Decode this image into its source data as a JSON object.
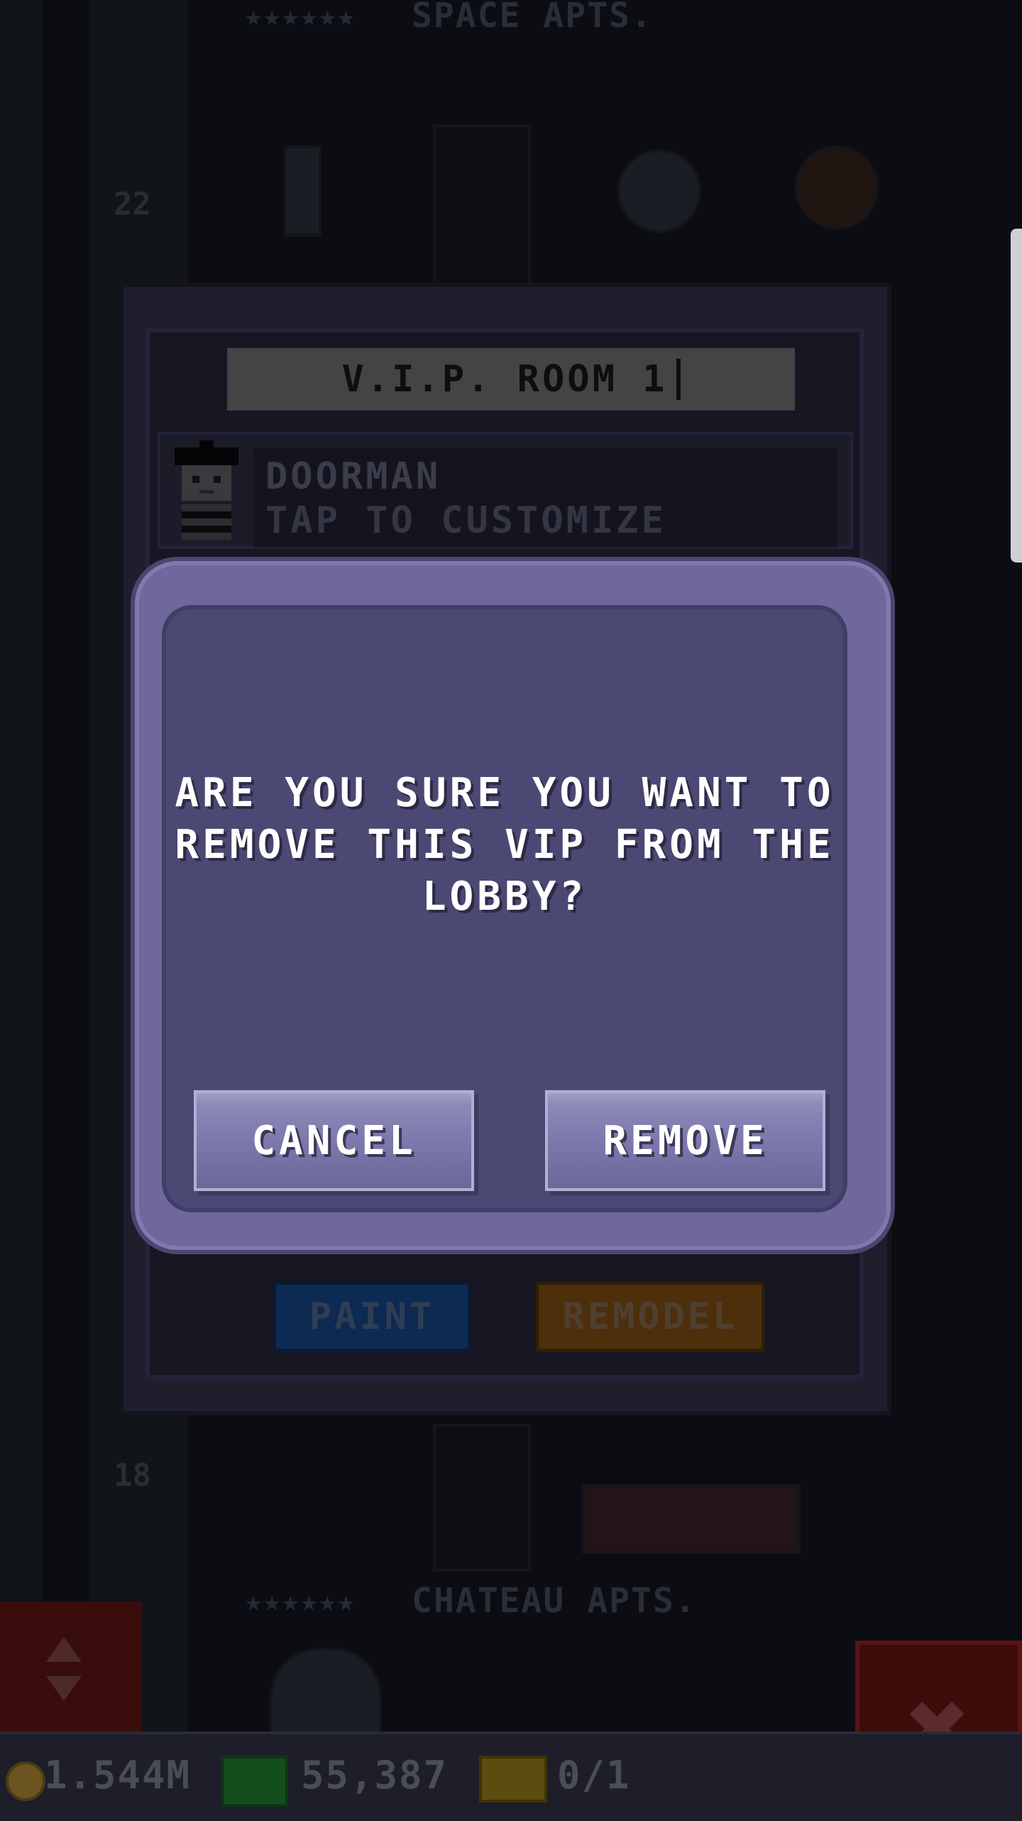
{
  "background": {
    "top_floor_stars": "★★★★★★",
    "top_floor_name": "SPACE APTS.",
    "top_floor_number": "22",
    "lower_floor_number": "18",
    "lower_floor_stars": "★★★★★★",
    "lower_floor_name": "CHATEAU APTS."
  },
  "room_panel": {
    "title": "V.I.P. ROOM 1",
    "staff_name": "DOORMAN",
    "staff_hint": "TAP TO CUSTOMIZE",
    "paint_label": "PAINT",
    "remodel_label": "REMODEL"
  },
  "dialog": {
    "line1": "ARE YOU SURE YOU WANT TO",
    "line2": "REMOVE THIS VIP FROM THE",
    "line3": "LOBBY?",
    "cancel_label": "CANCEL",
    "remove_label": "REMOVE"
  },
  "hud": {
    "coins": "1.544M",
    "bux": "55,387",
    "tickets": "0/1"
  },
  "controls": {
    "close_glyph": "✖"
  },
  "colors": {
    "dialog_face": "#4b4873",
    "dialog_border": "#6e689c",
    "button": "#7b77aa",
    "paint": "#0d2a52",
    "remodel": "#4d2f0c"
  }
}
